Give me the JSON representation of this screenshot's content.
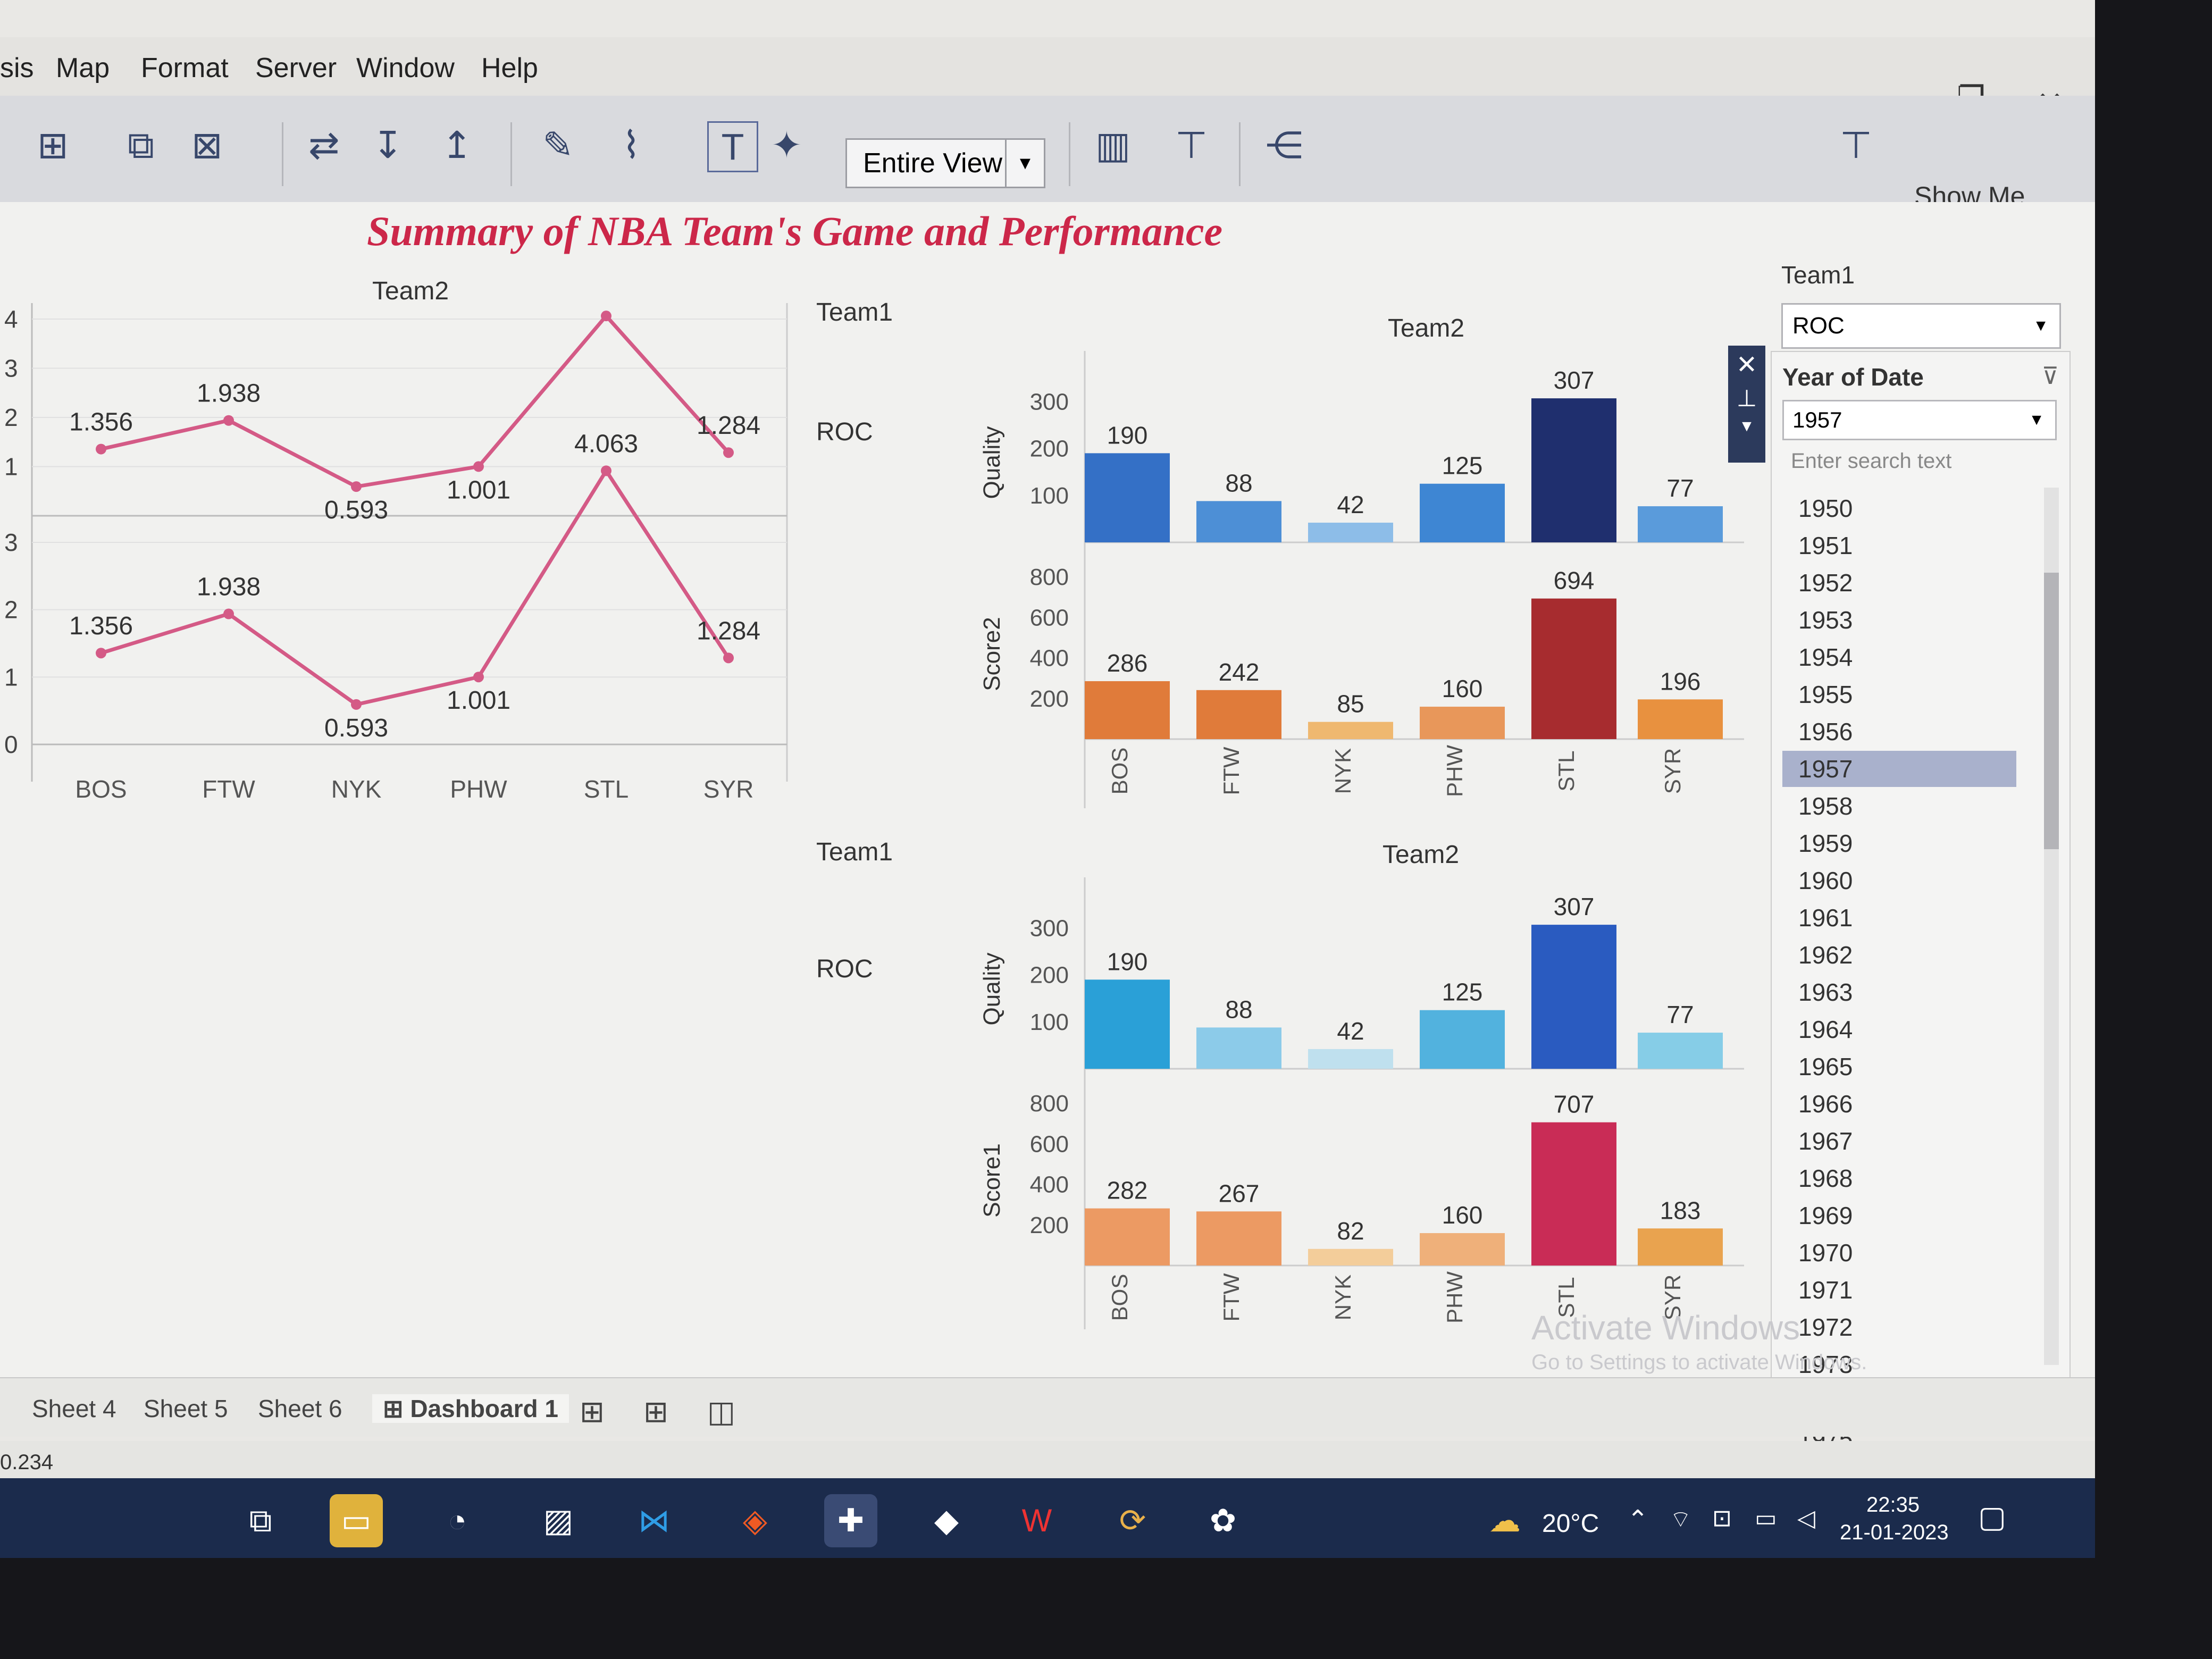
{
  "menu": [
    "sis",
    "Map",
    "Format",
    "Server",
    "Window",
    "Help"
  ],
  "window_controls": {
    "minimize": "—",
    "restore": "❐",
    "close": "✕"
  },
  "toolbar": {
    "view_select": "Entire View",
    "show_me": "Show Me"
  },
  "dashboard_title": "Summary of NBA Team's Game and Performance",
  "line_chart_header": "Team2",
  "bar_panels": [
    {
      "header_left": "Team1",
      "header_right": "Team2",
      "team": "ROC"
    },
    {
      "header_left": "Team1",
      "header_right": "Team2",
      "team": "ROC"
    }
  ],
  "chart_data": [
    {
      "type": "line",
      "categories": [
        "BOS",
        "FTW",
        "NYK",
        "PHW",
        "STL",
        "SYR"
      ],
      "panes": [
        {
          "values": [
            1.356,
            1.938,
            0.593,
            1.001,
            4.063,
            1.284
          ],
          "ytick_labels": [
            "4",
            "3",
            "2",
            "1"
          ],
          "ylim": [
            0,
            4
          ]
        },
        {
          "values": [
            1.356,
            1.938,
            0.593,
            1.001,
            4.063,
            1.284
          ],
          "ytick_labels": [
            "3",
            "2",
            "1",
            "0"
          ],
          "ylim": [
            0,
            3
          ]
        }
      ],
      "color": "#d45a86"
    },
    {
      "type": "bar",
      "categories": [
        "BOS",
        "FTW",
        "NYK",
        "PHW",
        "STL",
        "SYR"
      ],
      "series": [
        {
          "name": "Quality",
          "values": [
            190,
            88,
            42,
            125,
            307,
            77
          ],
          "yticks": [
            100,
            200,
            300
          ],
          "ylim": [
            0,
            340
          ],
          "colors": [
            "#3470c6",
            "#4d8fd6",
            "#8dbde8",
            "#3e86d3",
            "#1f2f6e",
            "#5a9bdb"
          ]
        },
        {
          "name": "Score2",
          "values": [
            286,
            242,
            85,
            160,
            694,
            196
          ],
          "yticks": [
            200,
            400,
            600,
            800
          ],
          "ylim": [
            0,
            840
          ],
          "colors": [
            "#e07b3a",
            "#e07b3a",
            "#efb870",
            "#e8975a",
            "#a72c2f",
            "#e8913f"
          ]
        }
      ]
    },
    {
      "type": "bar",
      "categories": [
        "BOS",
        "FTW",
        "NYK",
        "PHW",
        "STL",
        "SYR"
      ],
      "series": [
        {
          "name": "Quality",
          "values": [
            190,
            88,
            42,
            125,
            307,
            77
          ],
          "yticks": [
            100,
            200,
            300
          ],
          "ylim": [
            0,
            340
          ],
          "colors": [
            "#2aa0d7",
            "#8ccbe9",
            "#bfe0ee",
            "#52b2de",
            "#2a5bc0",
            "#86cde7"
          ]
        },
        {
          "name": "Score1",
          "values": [
            282,
            267,
            82,
            160,
            707,
            183
          ],
          "yticks": [
            200,
            400,
            600,
            800
          ],
          "ylim": [
            0,
            840
          ],
          "colors": [
            "#ec9a63",
            "#ec9a63",
            "#f3cd9a",
            "#efb07a",
            "#c92c56",
            "#e9a34f"
          ]
        }
      ]
    }
  ],
  "filters": {
    "team1_label": "Team1",
    "team1_value": "ROC",
    "year_label": "Year of Date",
    "year_value": "1957",
    "search_placeholder": "Enter search text",
    "years": [
      "1950",
      "1951",
      "1952",
      "1953",
      "1954",
      "1955",
      "1956",
      "1957",
      "1958",
      "1959",
      "1960",
      "1961",
      "1962",
      "1963",
      "1964",
      "1965",
      "1966",
      "1967",
      "1968",
      "1969",
      "1970",
      "1971",
      "1972",
      "1973",
      "1974",
      "1975"
    ],
    "selected_year": "1957"
  },
  "tabs": [
    "Sheet 4",
    "Sheet 5",
    "Sheet 6",
    "Dashboard 1"
  ],
  "status_text": "0.234",
  "watermark": {
    "line1": "Activate Windows",
    "line2": "Go to Settings to activate Windows."
  },
  "taskbar": {
    "weather": "20°C",
    "time": "22:35",
    "date": "21-01-2023"
  }
}
